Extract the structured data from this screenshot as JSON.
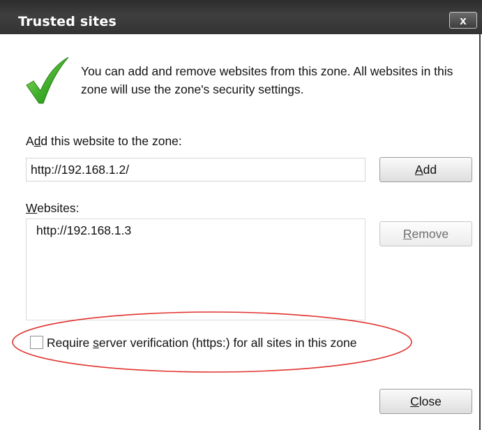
{
  "window": {
    "title": "Trusted sites",
    "close_glyph": "x"
  },
  "intro": {
    "icon": "checkmark-icon",
    "text": "You can add and remove websites from this zone. All websites in this zone will use the zone's security settings."
  },
  "add_site": {
    "label_pre": "A",
    "label_key": "d",
    "label_post": "d this website to the zone:",
    "input_value": "http://192.168.1.2/",
    "button_key": "A",
    "button_rest": "dd"
  },
  "websites": {
    "label_key": "W",
    "label_post": "ebsites:",
    "items": [
      "http://192.168.1.3"
    ],
    "remove_key": "R",
    "remove_rest": "emove"
  },
  "verification": {
    "checked": false,
    "label_pre": "Require ",
    "label_key": "s",
    "label_post": "erver verification (https:) for all sites in this zone",
    "highlight_color": "#e0322d"
  },
  "footer": {
    "close_key": "C",
    "close_rest": "lose"
  }
}
